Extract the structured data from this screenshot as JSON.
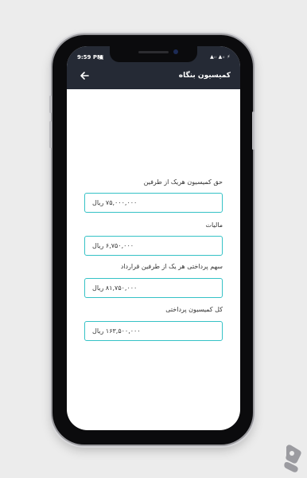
{
  "status_bar": {
    "time": "9:59 PM",
    "right_text": "▲ᵢₗ ▲ᵢₗ ⚡"
  },
  "header": {
    "title": "کمیسیون بنگاه"
  },
  "fields": [
    {
      "label": "حق کمیسیون هریک از طرفین",
      "value": "۷۵,۰۰۰,۰۰۰ ریال"
    },
    {
      "label": "مالیات",
      "value": "۶,۷۵۰,۰۰۰ ریال"
    },
    {
      "label": "سهم پرداختی هر یک از طرفین قرارداد",
      "value": "۸۱,۷۵۰,۰۰۰ ریال"
    },
    {
      "label": "کل کمیسیون پرداختی",
      "value": "۱۶۳,۵۰۰,۰۰۰ ریال"
    }
  ],
  "colors": {
    "header_bg": "#252a35",
    "field_border": "#35c2c6",
    "logo": "#9b9ba0"
  }
}
